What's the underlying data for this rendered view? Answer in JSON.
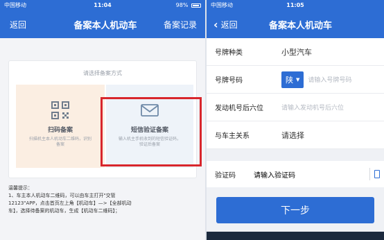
{
  "left": {
    "status": {
      "carrier": "中国移动",
      "time": "11:04",
      "battery": "98%"
    },
    "nav": {
      "back": "返回",
      "title": "备案本人机动车",
      "right": "备案记录"
    },
    "card": {
      "caption": "请选择备案方式",
      "options": [
        {
          "title": "扫码备案",
          "desc": "扫描机主本人机动车二维码，识别备案",
          "icon": "qr-code-icon"
        },
        {
          "title": "短信验证备案",
          "desc": "输入机主手机收到的短信验证码，验证后备案",
          "icon": "envelope-icon"
        }
      ]
    },
    "tips": [
      "温馨提示：",
      "1、车主本人机动车二维码，可以由车主打开\"交管",
      "12123\"APP，点击首页左上角【机动车】—>【全部机动",
      "车】，选择待备案的机动车，生成【机动车二维码】；"
    ]
  },
  "right": {
    "status": {
      "carrier": "中国移动",
      "time": "11:05"
    },
    "nav": {
      "back": "返回",
      "title": "备案本人机动车"
    },
    "form": {
      "plate_type": {
        "label": "号牌种类",
        "value": "小型汽车"
      },
      "plate_number": {
        "label": "号牌号码",
        "province": "陕",
        "placeholder": "请输入号牌号码"
      },
      "engine": {
        "label": "发动机号后六位",
        "placeholder": "请输入发动机号后六位"
      },
      "relation": {
        "label": "与车主关系",
        "value": "请选择"
      },
      "code": {
        "label": "验证码",
        "placeholder": "请输入验证码"
      }
    },
    "next_button": "下一步"
  },
  "colors": {
    "brand": "#2d6dd4",
    "highlight": "#d8262c"
  }
}
